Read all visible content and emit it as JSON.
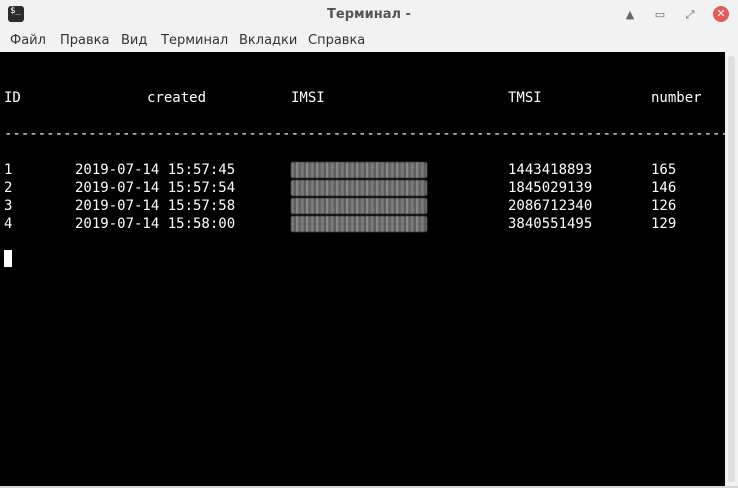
{
  "window": {
    "title": "Терминал -",
    "app_icon_glyph": "$_",
    "minimize_glyph": "▲",
    "restore_glyph": "▭",
    "settings_glyph": "⤢",
    "close_glyph": "✕"
  },
  "menu": [
    "Файл",
    "Правка",
    "Вид",
    "Терминал",
    "Вкладки",
    "Справка"
  ],
  "terminal": {
    "columns": [
      "ID",
      "created",
      "IMSI",
      "TMSI",
      "number"
    ],
    "separator": "------------------------------------------------------------------------------------------------------------",
    "rows": [
      {
        "id": "1",
        "created": "2019-07-14 15:57:45",
        "imsi": "",
        "tmsi": "1443418893",
        "number": "165"
      },
      {
        "id": "2",
        "created": "2019-07-14 15:57:54",
        "imsi": "",
        "tmsi": "1845029139",
        "number": "146"
      },
      {
        "id": "3",
        "created": "2019-07-14 15:57:58",
        "imsi": "",
        "tmsi": "2086712340",
        "number": "126"
      },
      {
        "id": "4",
        "created": "2019-07-14 15:58:00",
        "imsi": "",
        "tmsi": "3840551495",
        "number": "129"
      }
    ],
    "colors": {
      "background": "#000000",
      "foreground": "#ffffff"
    }
  }
}
